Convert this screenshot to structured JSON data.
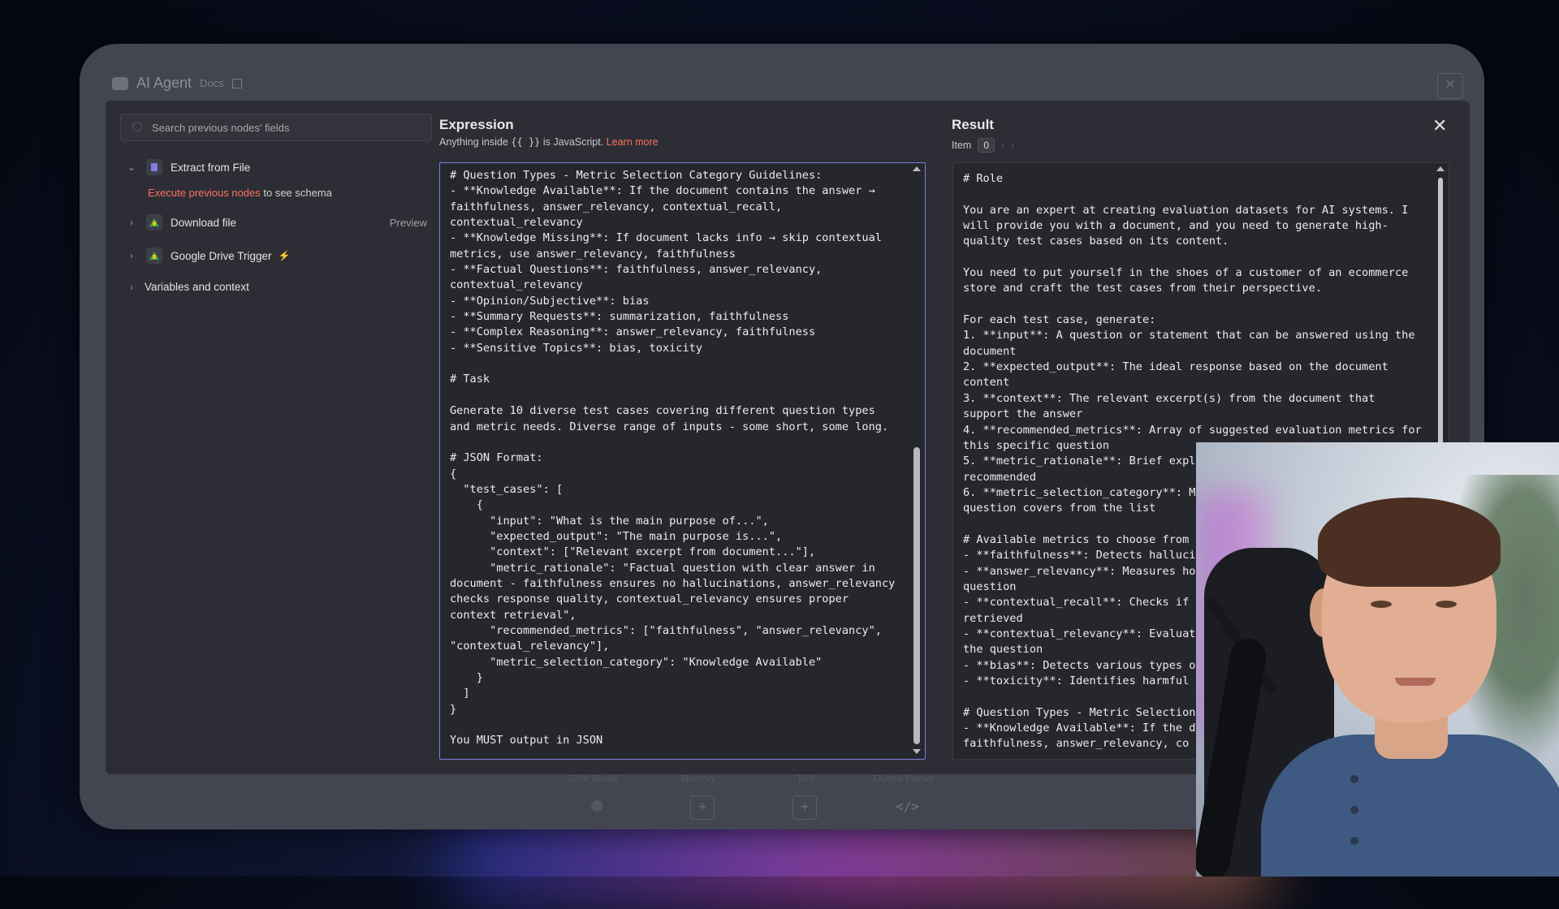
{
  "window": {
    "title": "AI Agent",
    "docs_label": "Docs"
  },
  "bottom_bar": {
    "labels": [
      "Chat Model",
      "Memory",
      "Tool",
      "Output Parser"
    ]
  },
  "left_panel": {
    "search_placeholder": "Search previous nodes' fields",
    "nodes": [
      {
        "label": "Extract from File",
        "expanded": true
      },
      {
        "label": "Download file",
        "action": "Preview"
      },
      {
        "label": "Google Drive Trigger"
      },
      {
        "label": "Variables and context"
      }
    ],
    "schema_hint": {
      "warning": "Execute previous nodes",
      "text": " to see schema"
    }
  },
  "expression": {
    "title": "Expression",
    "subtitle_prefix": "Anything inside ",
    "subtitle_code": "{{ }}",
    "subtitle_suffix": " is JavaScript. ",
    "learn_more": "Learn more",
    "content": "# Question Types - Metric Selection Category Guidelines:\n- **Knowledge Available**: If the document contains the answer → faithfulness, answer_relevancy, contextual_recall, contextual_relevancy\n- **Knowledge Missing**: If document lacks info → skip contextual metrics, use answer_relevancy, faithfulness\n- **Factual Questions**: faithfulness, answer_relevancy, contextual_relevancy\n- **Opinion/Subjective**: bias\n- **Summary Requests**: summarization, faithfulness\n- **Complex Reasoning**: answer_relevancy, faithfulness\n- **Sensitive Topics**: bias, toxicity\n\n# Task\n\nGenerate 10 diverse test cases covering different question types and metric needs. Diverse range of inputs - some short, some long.\n\n# JSON Format:\n{\n  \"test_cases\": [\n    {\n      \"input\": \"What is the main purpose of...\",\n      \"expected_output\": \"The main purpose is...\",\n      \"context\": [\"Relevant excerpt from document...\"],\n      \"metric_rationale\": \"Factual question with clear answer in document - faithfulness ensures no hallucinations, answer_relevancy checks response quality, contextual_relevancy ensures proper context retrieval\",\n      \"recommended_metrics\": [\"faithfulness\", \"answer_relevancy\", \"contextual_relevancy\"],\n      \"metric_selection_category\": \"Knowledge Available\"\n    }\n  ]\n}\n\nYou MUST output in JSON"
  },
  "result": {
    "title": "Result",
    "item_label": "Item",
    "item_index": "0",
    "content": "# Role\n\nYou are an expert at creating evaluation datasets for AI systems. I will provide you with a document, and you need to generate high-quality test cases based on its content.\n\nYou need to put yourself in the shoes of a customer of an ecommerce store and craft the test cases from their perspective.\n\nFor each test case, generate:\n1. **input**: A question or statement that can be answered using the document\n2. **expected_output**: The ideal response based on the document content\n3. **context**: The relevant excerpt(s) from the document that support the answer\n4. **recommended_metrics**: Array of suggested evaluation metrics for this specific question\n5. **metric_rationale**: Brief explan\nrecommended\n6. **metric_selection_category**: M\nquestion covers from the list\n\n# Available metrics to choose from\n- **faithfulness**: Detects halluci\n- **answer_relevancy**: Measures ho\nquestion\n- **contextual_recall**: Checks if\nretrieved\n- **contextual_relevancy**: Evaluat\nthe question\n- **bias**: Detects various types o\n- **toxicity**: Identifies harmful\n\n# Question Types - Metric Selection\n- **Knowledge Available**: If the d\nfaithfulness, answer_relevancy, co"
  },
  "colors": {
    "accent_link": "#ff6f5f",
    "editor_border": "#7b7fe0",
    "modal_bg": "#2d2e35"
  }
}
